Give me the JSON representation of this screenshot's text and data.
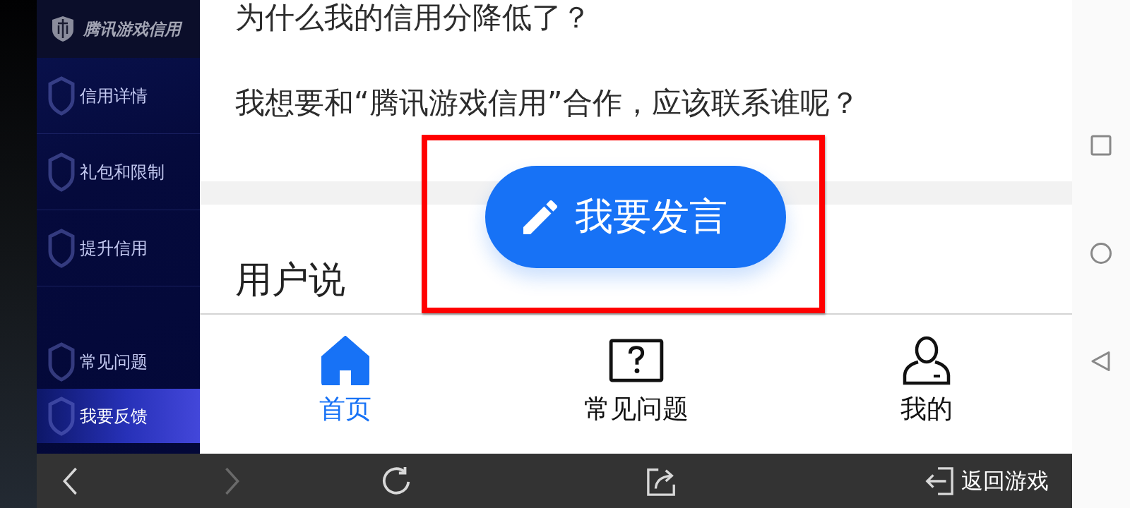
{
  "sidebar": {
    "logo_text": "腾讯游戏信用",
    "top_items": [
      {
        "label": "信用详情",
        "selected": false
      },
      {
        "label": "礼包和限制",
        "selected": false
      },
      {
        "label": "提升信用",
        "selected": false
      }
    ],
    "bottom_items": [
      {
        "label": "常见问题",
        "selected": false
      },
      {
        "label": "我要反馈",
        "selected": true
      }
    ]
  },
  "content": {
    "questions": [
      "为什么我的信用分降低了？",
      "我想要和“腾讯游戏信用”合作，应该联系谁呢？"
    ],
    "section_title": "用户说"
  },
  "post_button": {
    "label": "我要发言"
  },
  "bottom_nav": [
    {
      "label": "首页",
      "kind": "home",
      "selected": true
    },
    {
      "label": "常见问题",
      "kind": "faq",
      "selected": false
    },
    {
      "label": "我的",
      "kind": "profile",
      "selected": false
    }
  ],
  "browser_toolbar": {
    "buttons": [
      {
        "kind": "back",
        "disabled": false
      },
      {
        "kind": "forward",
        "disabled": true
      },
      {
        "kind": "refresh",
        "disabled": false
      },
      {
        "kind": "share",
        "disabled": false
      }
    ],
    "return_label": "返回游戏"
  },
  "system_nav": [
    {
      "kind": "recents"
    },
    {
      "kind": "home"
    },
    {
      "kind": "back"
    }
  ]
}
